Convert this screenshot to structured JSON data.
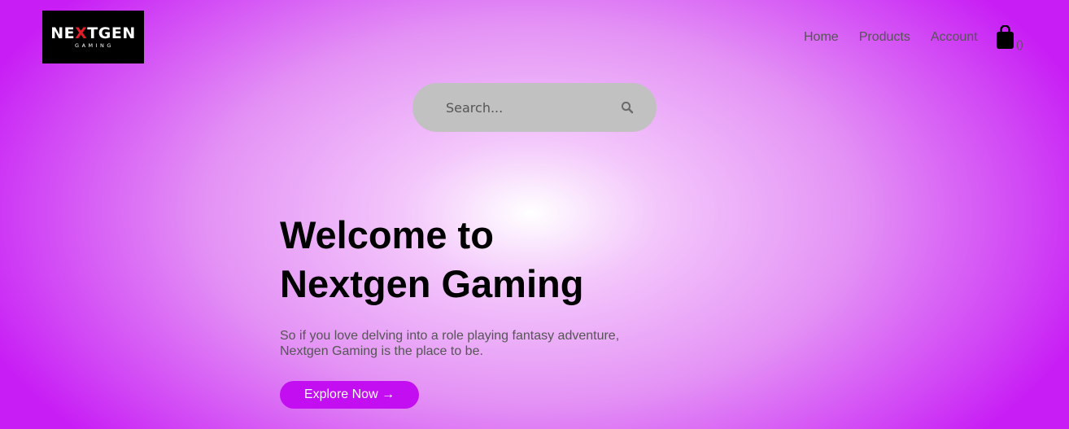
{
  "brand": {
    "logo_pre": "NE",
    "logo_x": "X",
    "logo_post": "TGEN",
    "logo_sub": "GAMING"
  },
  "nav": {
    "items": [
      {
        "label": "Home"
      },
      {
        "label": "Products"
      },
      {
        "label": "Account"
      }
    ],
    "cart_icon": "shopping-bag-icon",
    "cart_count": "()"
  },
  "search": {
    "placeholder": "Search...",
    "value": "",
    "icon": "search-icon"
  },
  "hero": {
    "title_line1": "Welcome to",
    "title_line2": "Nextgen Gaming",
    "description_line1": "So if you love delving into a role playing fantasy adventure,",
    "description_line2": "Nextgen Gaming is the place to be.",
    "cta_label": "Explore Now →"
  },
  "colors": {
    "background_center": "#ffffff",
    "background_edge": "#c81ef5",
    "accent": "#c30ef1",
    "search_bg": "#c1c1c1",
    "logo_x": "#e11d2a"
  }
}
